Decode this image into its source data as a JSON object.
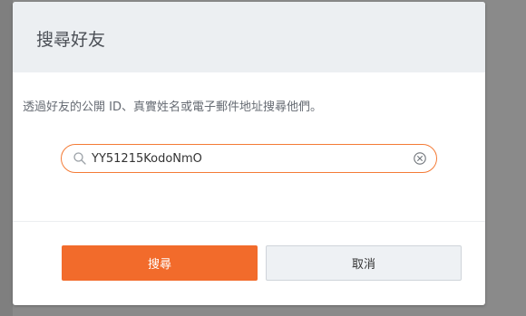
{
  "dialog": {
    "title": "搜尋好友",
    "description": "透過好友的公開 ID、真實姓名或電子郵件地址搜尋他們。",
    "search": {
      "value": "YY51215KodoNmO",
      "search_icon": "search-icon",
      "clear_icon": "clear-circle-x-icon"
    },
    "buttons": {
      "search_label": "搜尋",
      "cancel_label": "取消"
    }
  },
  "colors": {
    "accent": "#f26b2b",
    "input_border": "#f47b36",
    "header_bg": "#eceff2",
    "overlay": "#8a8a8a",
    "secondary_button_bg": "#eef1f4"
  }
}
